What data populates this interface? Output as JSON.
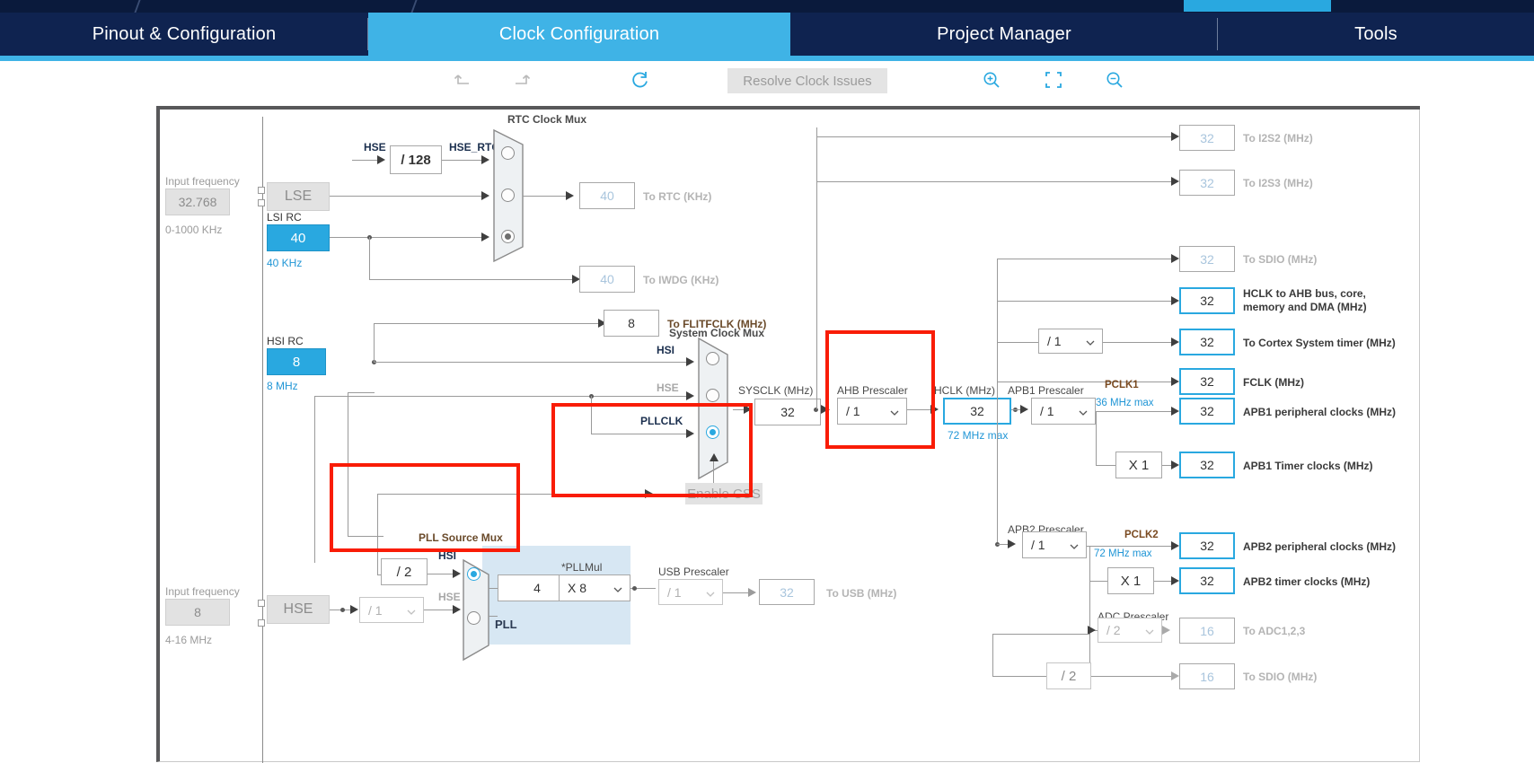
{
  "window": {
    "top_button_label": ""
  },
  "nav": {
    "tabs": [
      {
        "label": "Pinout & Configuration",
        "active": false
      },
      {
        "label": "Clock Configuration",
        "active": true
      },
      {
        "label": "Project Manager",
        "active": false
      },
      {
        "label": "Tools",
        "active": false
      }
    ]
  },
  "toolbar": {
    "undo": "undo-icon",
    "redo": "redo-icon",
    "reset": "reset-icon",
    "resolve_label": "Resolve Clock Issues",
    "zoom_in": "zoom-in-icon",
    "fit": "fit-to-screen-icon",
    "zoom_out": "zoom-out-icon"
  },
  "diagram": {
    "lse": {
      "input_frequency_label": "Input frequency",
      "input_frequency_value": "32.768",
      "range": "0-1000 KHz",
      "button": "LSE"
    },
    "lsi": {
      "title": "LSI RC",
      "value": "40",
      "unit": "40 KHz"
    },
    "hsi": {
      "title": "HSI RC",
      "value": "8",
      "unit": "8 MHz"
    },
    "hse": {
      "input_frequency_label": "Input frequency",
      "input_frequency_value": "8",
      "range": "4-16 MHz",
      "button": "HSE",
      "prescaler": "/ 1"
    },
    "hse_div128": "/ 128",
    "rtc_mux": {
      "title": "RTC Clock Mux",
      "inputs": [
        "HSE_RTC",
        "LSE",
        "LSI"
      ],
      "selected_index": 2
    },
    "to_rtc": {
      "value": "40",
      "label": "To RTC (KHz)"
    },
    "to_iwdg": {
      "value": "40",
      "label": "To IWDG (KHz)"
    },
    "to_flitfclk": {
      "value": "8",
      "label": "To FLITFCLK (MHz)"
    },
    "sys_mux": {
      "title": "System Clock Mux",
      "inputs": [
        "HSI",
        "HSE",
        "PLLCLK"
      ],
      "selected_index": 2
    },
    "enable_css": "Enable CSS",
    "sysclk": {
      "label": "SYSCLK (MHz)",
      "value": "32"
    },
    "pll_source_mux": {
      "title": "PLL Source Mux",
      "inputs": [
        "HSI",
        "HSE"
      ],
      "selected_index": 0,
      "hsi_div": "/ 2"
    },
    "pll": {
      "panel_label": "PLL",
      "input_value": "4",
      "mul_label": "*PLLMul",
      "mul_value": "X 8"
    },
    "usb_prescaler": {
      "title": "USB Prescaler",
      "value": "/ 1"
    },
    "to_usb": {
      "value": "32",
      "label": "To USB (MHz)"
    },
    "ahb_prescaler": {
      "title": "AHB Prescaler",
      "value": "/ 1"
    },
    "hclk": {
      "label": "HCLK (MHz)",
      "value": "32",
      "max": "72 MHz max"
    },
    "apb1_prescaler": {
      "title": "APB1 Prescaler",
      "value": "/ 1"
    },
    "pclk1": {
      "label": "PCLK1",
      "max": "36 MHz max"
    },
    "apb1_timer_mul": "X 1",
    "apb2_prescaler": {
      "title": "APB2 Prescaler",
      "value": "/ 1"
    },
    "pclk2": {
      "label": "PCLK2",
      "max": "72 MHz max"
    },
    "apb2_timer_mul": "X 1",
    "adc_prescaler": {
      "title": "ADC Prescaler",
      "value": "/ 2"
    },
    "cortex_prescaler": "/ 1",
    "sdio_div2": "/ 2",
    "outputs": [
      {
        "value": "32",
        "label": "To I2S2 (MHz)",
        "active": false
      },
      {
        "value": "32",
        "label": "To I2S3 (MHz)",
        "active": false
      },
      {
        "value": "32",
        "label": "To SDIO (MHz)",
        "active": false
      },
      {
        "value": "32",
        "label": "HCLK to AHB bus, core,",
        "label2": "memory and DMA (MHz)",
        "active": true
      },
      {
        "value": "32",
        "label": "To Cortex System timer (MHz)",
        "active": true
      },
      {
        "value": "32",
        "label": "FCLK (MHz)",
        "active": true
      },
      {
        "value": "32",
        "label": "APB1 peripheral clocks (MHz)",
        "active": true
      },
      {
        "value": "32",
        "label": "APB1 Timer clocks (MHz)",
        "active": true
      },
      {
        "value": "32",
        "label": "APB2 peripheral clocks (MHz)",
        "active": true
      },
      {
        "value": "32",
        "label": "APB2 timer clocks (MHz)",
        "active": true
      },
      {
        "value": "16",
        "label": "To ADC1,2,3",
        "active": false
      },
      {
        "value": "16",
        "label": "To SDIO (MHz)",
        "active": false
      }
    ]
  },
  "colors": {
    "nav_bg": "#0f2350",
    "accent": "#3fb3e6",
    "highlight": "#f91c06",
    "cyan_fill": "#29a8e0"
  }
}
